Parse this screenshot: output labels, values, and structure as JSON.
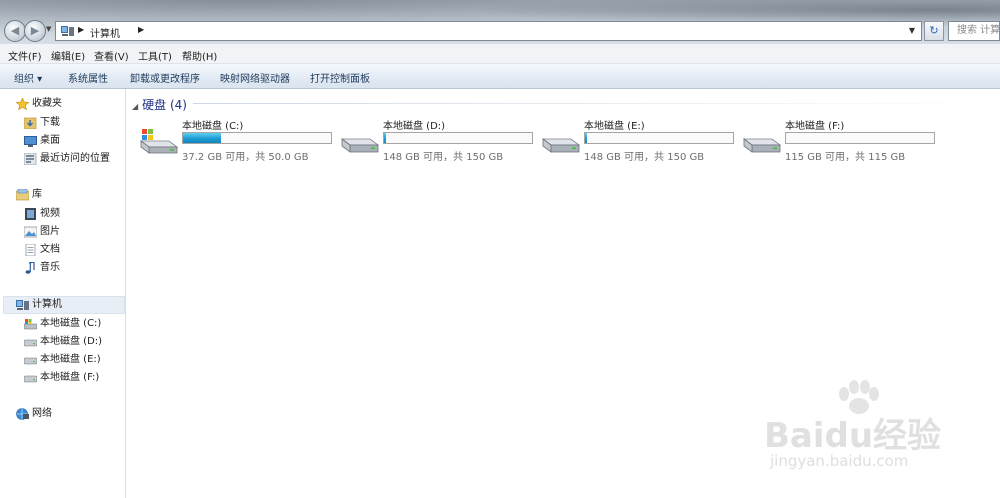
{
  "address": {
    "path": "计算机"
  },
  "search": {
    "placeholder": "搜索 计算机"
  },
  "menu": [
    "文件(F)",
    "编辑(E)",
    "查看(V)",
    "工具(T)",
    "帮助(H)"
  ],
  "commands": [
    "组织 ▾",
    "系统属性",
    "卸载或更改程序",
    "映射网络驱动器",
    "打开控制面板"
  ],
  "nav": {
    "favorites": {
      "label": "收藏夹",
      "items": [
        "下载",
        "桌面",
        "最近访问的位置"
      ]
    },
    "libraries": {
      "label": "库",
      "items": [
        "视频",
        "图片",
        "文档",
        "音乐"
      ]
    },
    "computer": {
      "label": "计算机",
      "items": [
        "本地磁盘 (C:)",
        "本地磁盘 (D:)",
        "本地磁盘 (E:)",
        "本地磁盘 (F:)"
      ]
    },
    "network": {
      "label": "网络"
    }
  },
  "group": {
    "title": "硬盘 (4)"
  },
  "drives": [
    {
      "name": "本地磁盘 (C:)",
      "free": "37.2 GB 可用，共 50.0 GB",
      "used_fraction": 0.256,
      "system": true
    },
    {
      "name": "本地磁盘 (D:)",
      "free": "148 GB 可用，共 150 GB",
      "used_fraction": 0.013,
      "system": false
    },
    {
      "name": "本地磁盘 (E:)",
      "free": "148 GB 可用，共 150 GB",
      "used_fraction": 0.013,
      "system": false
    },
    {
      "name": "本地磁盘 (F:)",
      "free": "115 GB 可用，共 115 GB",
      "used_fraction": 0.0,
      "system": false
    }
  ],
  "watermark": {
    "brand": "Baidu经验",
    "url": "jingyan.baidu.com"
  }
}
